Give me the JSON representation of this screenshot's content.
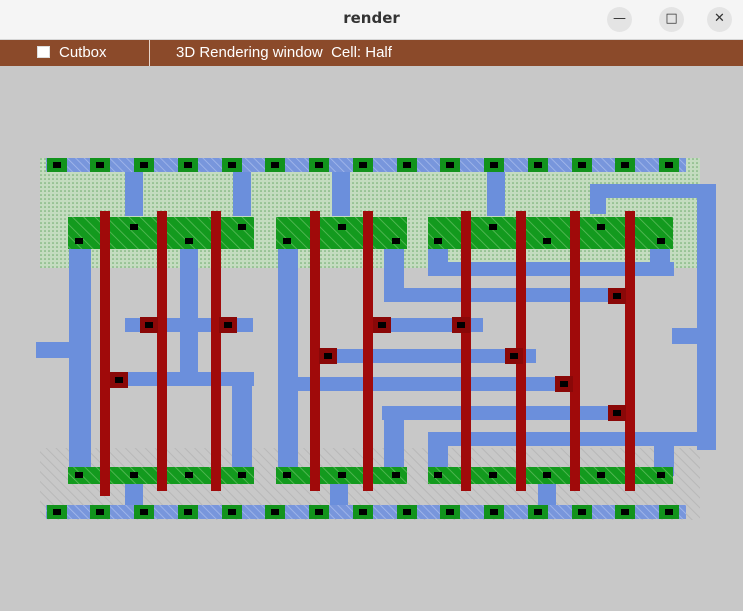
{
  "window": {
    "title": "render",
    "buttons": {
      "minimize": "—",
      "maximize": "□",
      "close": "✕"
    }
  },
  "toolbar": {
    "cutbox_label": "Cutbox",
    "cutbox_checked": false,
    "status": "3D Rendering window  Cell: Half"
  },
  "colors": {
    "background": "#c8c8c8",
    "toolbar": "#8b4a2a",
    "metal": "#6b8fdc",
    "poly": "#a00a0a",
    "diffusion": "#12931c",
    "contact": "#000000",
    "well": "#c4dcc0"
  }
}
